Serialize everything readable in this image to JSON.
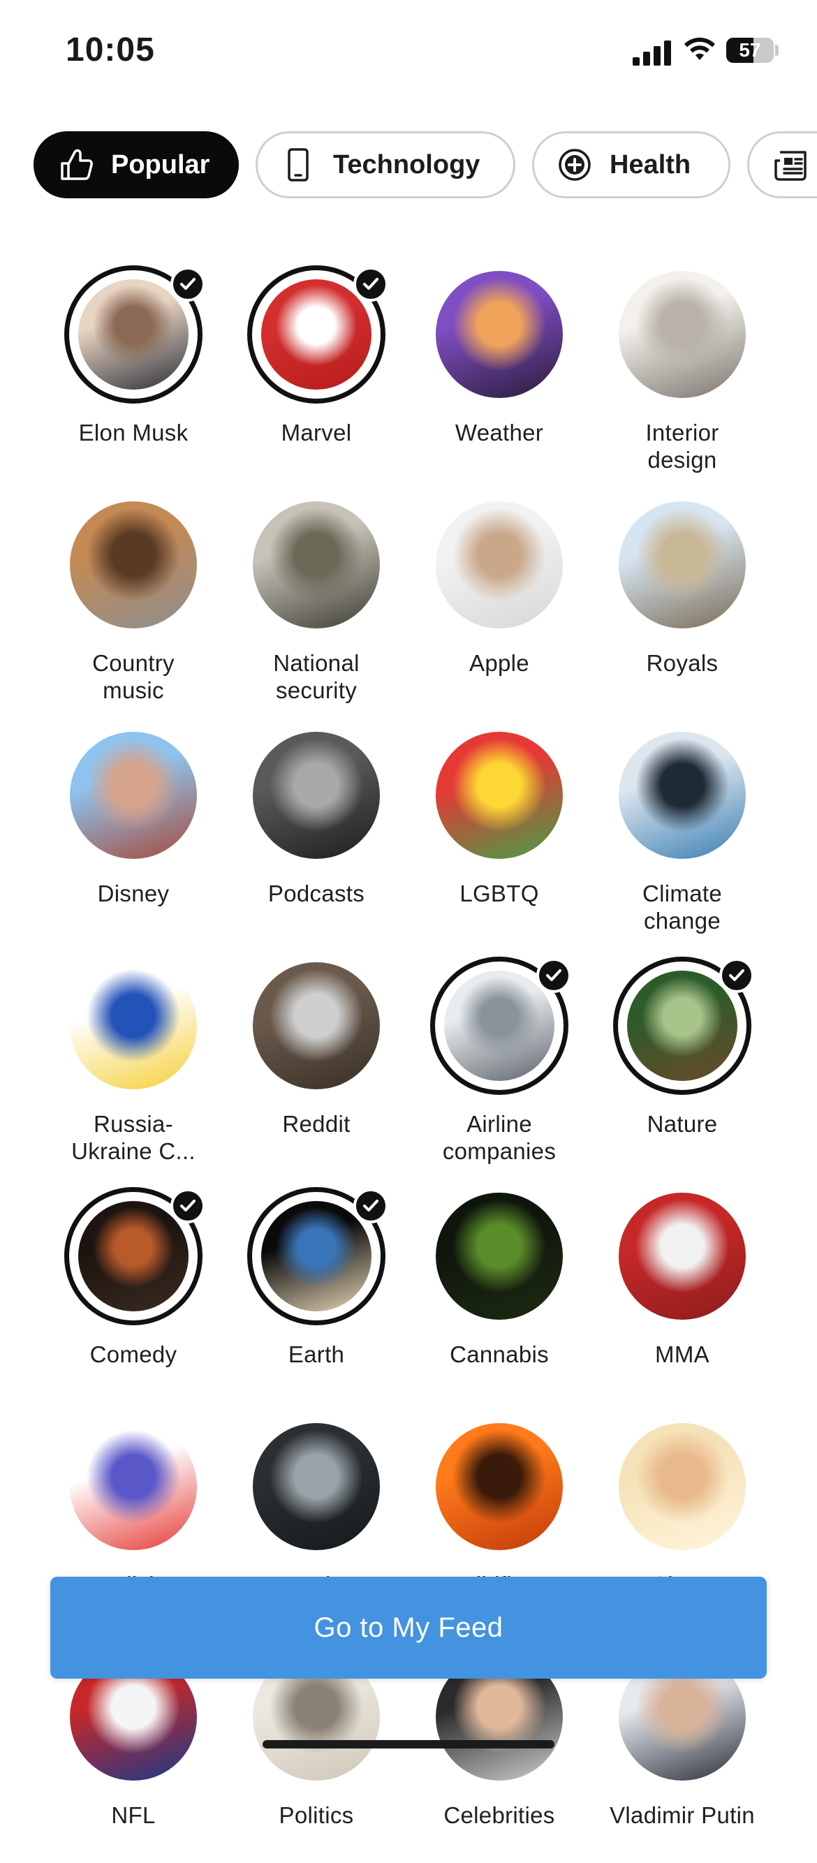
{
  "status_bar": {
    "time": "10:05",
    "battery": "57",
    "battery_level": 0.57
  },
  "categories": [
    {
      "label": "Popular",
      "icon": "thumbs-up-icon",
      "active": true
    },
    {
      "label": "Technology",
      "icon": "smartphone-icon",
      "active": false
    },
    {
      "label": "Health",
      "icon": "plus-circle-icon",
      "active": false
    },
    {
      "label": "",
      "icon": "newspaper-icon",
      "active": false
    }
  ],
  "topics": [
    {
      "label": "Elon Musk",
      "selected": true,
      "colors": [
        "#e8d4c2",
        "#8a6a55",
        "#2c2f3a"
      ]
    },
    {
      "label": "Marvel",
      "selected": true,
      "colors": [
        "#d32f2f",
        "#ffffff",
        "#b71c1c"
      ]
    },
    {
      "label": "Weather",
      "selected": false,
      "colors": [
        "#7e4ec2",
        "#f0a35a",
        "#2a1c3a"
      ]
    },
    {
      "label": "Interior\ndesign",
      "selected": false,
      "colors": [
        "#f4f1ec",
        "#b8b2a8",
        "#7a746c"
      ]
    },
    {
      "label": "Country\nmusic",
      "selected": false,
      "colors": [
        "#c48a55",
        "#5a3a22",
        "#8e8e8e"
      ]
    },
    {
      "label": "National\nsecurity",
      "selected": false,
      "colors": [
        "#c7c2b8",
        "#6b6a58",
        "#3e3e34"
      ]
    },
    {
      "label": "Apple",
      "selected": false,
      "colors": [
        "#f2f2f2",
        "#c9a88a",
        "#d7d7d7"
      ]
    },
    {
      "label": "Royals",
      "selected": false,
      "colors": [
        "#d7e5f2",
        "#c9b896",
        "#7a6b55"
      ]
    },
    {
      "label": "Disney",
      "selected": false,
      "colors": [
        "#8fc3ee",
        "#d6a38c",
        "#a44a3a"
      ]
    },
    {
      "label": "Podcasts",
      "selected": false,
      "colors": [
        "#5a5a5a",
        "#a9a9a9",
        "#1e1e1e"
      ]
    },
    {
      "label": "LGBTQ",
      "selected": false,
      "colors": [
        "#e53935",
        "#fdd835",
        "#43a047"
      ]
    },
    {
      "label": "Climate\nchange",
      "selected": false,
      "colors": [
        "#dde6ef",
        "#1e2a36",
        "#3b7fb3"
      ]
    },
    {
      "label": "Russia-\nUkraine C...",
      "selected": false,
      "colors": [
        "#ffffff",
        "#2353b8",
        "#f5cf38"
      ]
    },
    {
      "label": "Reddit",
      "selected": false,
      "colors": [
        "#6a5a4c",
        "#cfcfcf",
        "#3a2f26"
      ]
    },
    {
      "label": "Airline\ncompanies",
      "selected": true,
      "colors": [
        "#e9ecef",
        "#8a939b",
        "#5e656c"
      ]
    },
    {
      "label": "Nature",
      "selected": true,
      "colors": [
        "#2e5b2a",
        "#a8c48a",
        "#6a4a2a"
      ]
    },
    {
      "label": "Comedy",
      "selected": true,
      "colors": [
        "#1c1410",
        "#b85a2a",
        "#3a2a20"
      ]
    },
    {
      "label": "Earth",
      "selected": true,
      "colors": [
        "#0a0a0a",
        "#3a74b8",
        "#e6d7b8"
      ]
    },
    {
      "label": "Cannabis",
      "selected": false,
      "colors": [
        "#0e160c",
        "#5b8c2a",
        "#1e2a12"
      ]
    },
    {
      "label": "MMA",
      "selected": false,
      "colors": [
        "#c62828",
        "#f1f1f1",
        "#8e1d1d"
      ]
    },
    {
      "label": "Medicine",
      "selected": false,
      "colors": [
        "#ffffff",
        "#5a57c9",
        "#e53935"
      ]
    },
    {
      "label": "Tesla",
      "selected": false,
      "colors": [
        "#2a2f33",
        "#9aa3a8",
        "#151a1d"
      ]
    },
    {
      "label": "Wildfires",
      "selected": false,
      "colors": [
        "#ff7a1a",
        "#3a1a0a",
        "#c23a0a"
      ]
    },
    {
      "label": "Sleep",
      "selected": false,
      "colors": [
        "#f6e2b8",
        "#e8b98a",
        "#fff4dc"
      ]
    },
    {
      "label": "NFL",
      "selected": false,
      "colors": [
        "#c62828",
        "#f5f5f5",
        "#1a3a8a"
      ]
    },
    {
      "label": "Politics",
      "selected": false,
      "colors": [
        "#ece8e0",
        "#8a8274",
        "#cfc7b8"
      ]
    },
    {
      "label": "Celebrities",
      "selected": false,
      "colors": [
        "#2a2a2a",
        "#e0b89a",
        "#cfcfcf"
      ]
    },
    {
      "label": "Vladimir Putin",
      "selected": false,
      "colors": [
        "#e6e9ee",
        "#d9b39a",
        "#2a2f3a"
      ]
    }
  ],
  "cta": {
    "label": "Go to My Feed"
  }
}
